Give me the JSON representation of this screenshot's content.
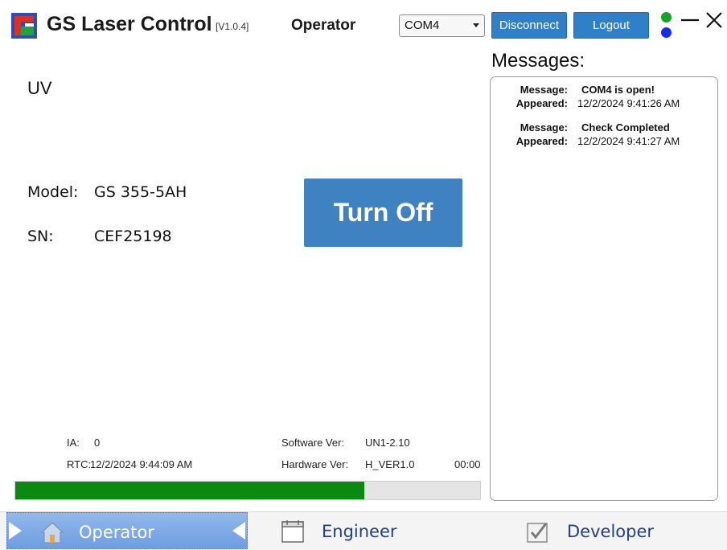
{
  "window": {
    "title": "GS Laser Control",
    "version": "[V1.0.4]",
    "role": "Operator",
    "port": {
      "selected": "COM4"
    },
    "disconnect_label": "Disconnect",
    "logout_label": "Logout",
    "status_colors": {
      "connection": "#16a523",
      "activity": "#1330e8"
    },
    "icons": {
      "logo": "gs-logo-icon",
      "minimize": "minimize-icon",
      "close": "close-icon"
    }
  },
  "laser": {
    "type": "UV",
    "model_label": "Model:",
    "model_value": "GS 355-5AH",
    "sn_label": "SN:",
    "sn_value": "CEF25198",
    "toggle_label": "Turn Off"
  },
  "status": {
    "ia_label": "IA:",
    "ia_value": "0",
    "rtc_label": "RTC:",
    "rtc_value": "12/2/2024 9:44:09 AM",
    "software_label": "Software Ver:",
    "software_value": "UN1-2.10",
    "hardware_label": "Hardware Ver:",
    "hardware_value": "H_VER1.0",
    "timer": "00:00",
    "progress": 0.75,
    "progress_color": "#0a8a10"
  },
  "messages": {
    "heading": "Messages:",
    "message_key": "Message:",
    "appeared_key": "Appeared:",
    "items": [
      {
        "message": "COM4 is open!",
        "appeared": "12/2/2024 9:41:26 AM"
      },
      {
        "message": "Check Completed",
        "appeared": "12/2/2024 9:41:27 AM"
      }
    ]
  },
  "tabs": [
    {
      "label": "Operator",
      "icon": "home-icon",
      "active": true
    },
    {
      "label": "Engineer",
      "icon": "window-icon",
      "active": false
    },
    {
      "label": "Developer",
      "icon": "checkbox-icon",
      "active": false
    }
  ]
}
